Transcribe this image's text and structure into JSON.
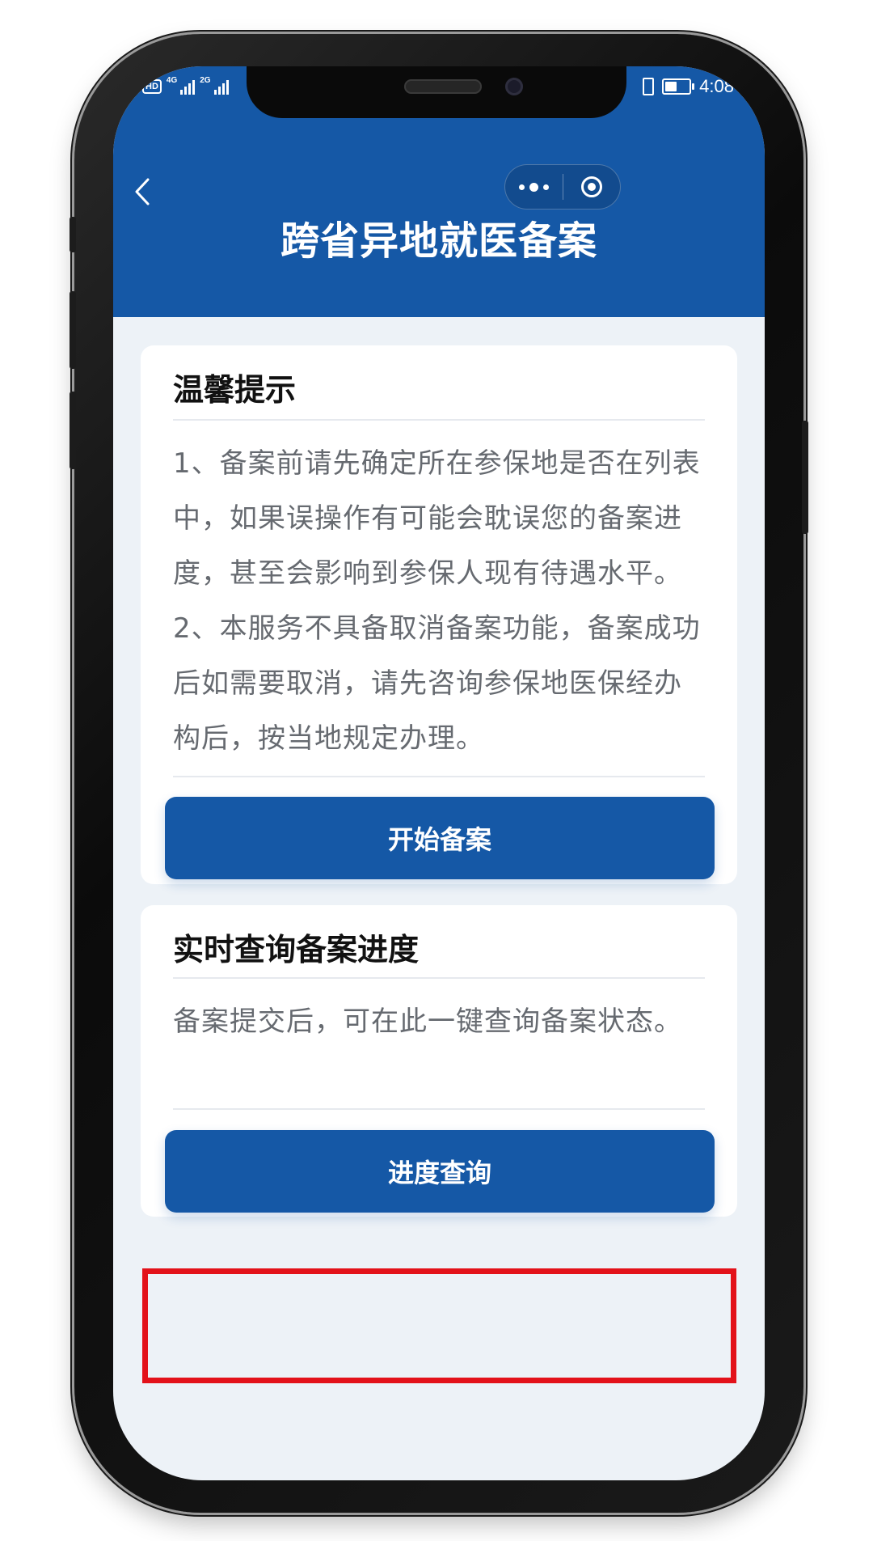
{
  "status_bar": {
    "net_label_1": "4G",
    "net_label_2": "2G",
    "hd_badge": "HD",
    "time": "4:08",
    "battery_level": 0.5
  },
  "nav": {
    "title": "跨省异地就医备案",
    "back_icon": "chevron-left-icon",
    "more_icon": "more-dots-icon",
    "close_icon": "target-circle-icon"
  },
  "notice_card": {
    "title": "温馨提示",
    "paragraphs": [
      "1、备案前请先确定所在参保地是否在列表中，如果误操作有可能会耽误您的备案进度，甚至会影响到参保人现有待遇水平。",
      "2、本服务不具备取消备案功能，备案成功后如需要取消，请先咨询参保地医保经办构后，按当地规定办理。"
    ],
    "button_label": "开始备案"
  },
  "progress_card": {
    "title": "实时查询备案进度",
    "text": "备案提交后，可在此一键查询备案状态。",
    "button_label": "进度查询"
  },
  "colors": {
    "primary": "#1558a6",
    "page_background": "#edf2f7",
    "highlight": "#e3121a"
  }
}
